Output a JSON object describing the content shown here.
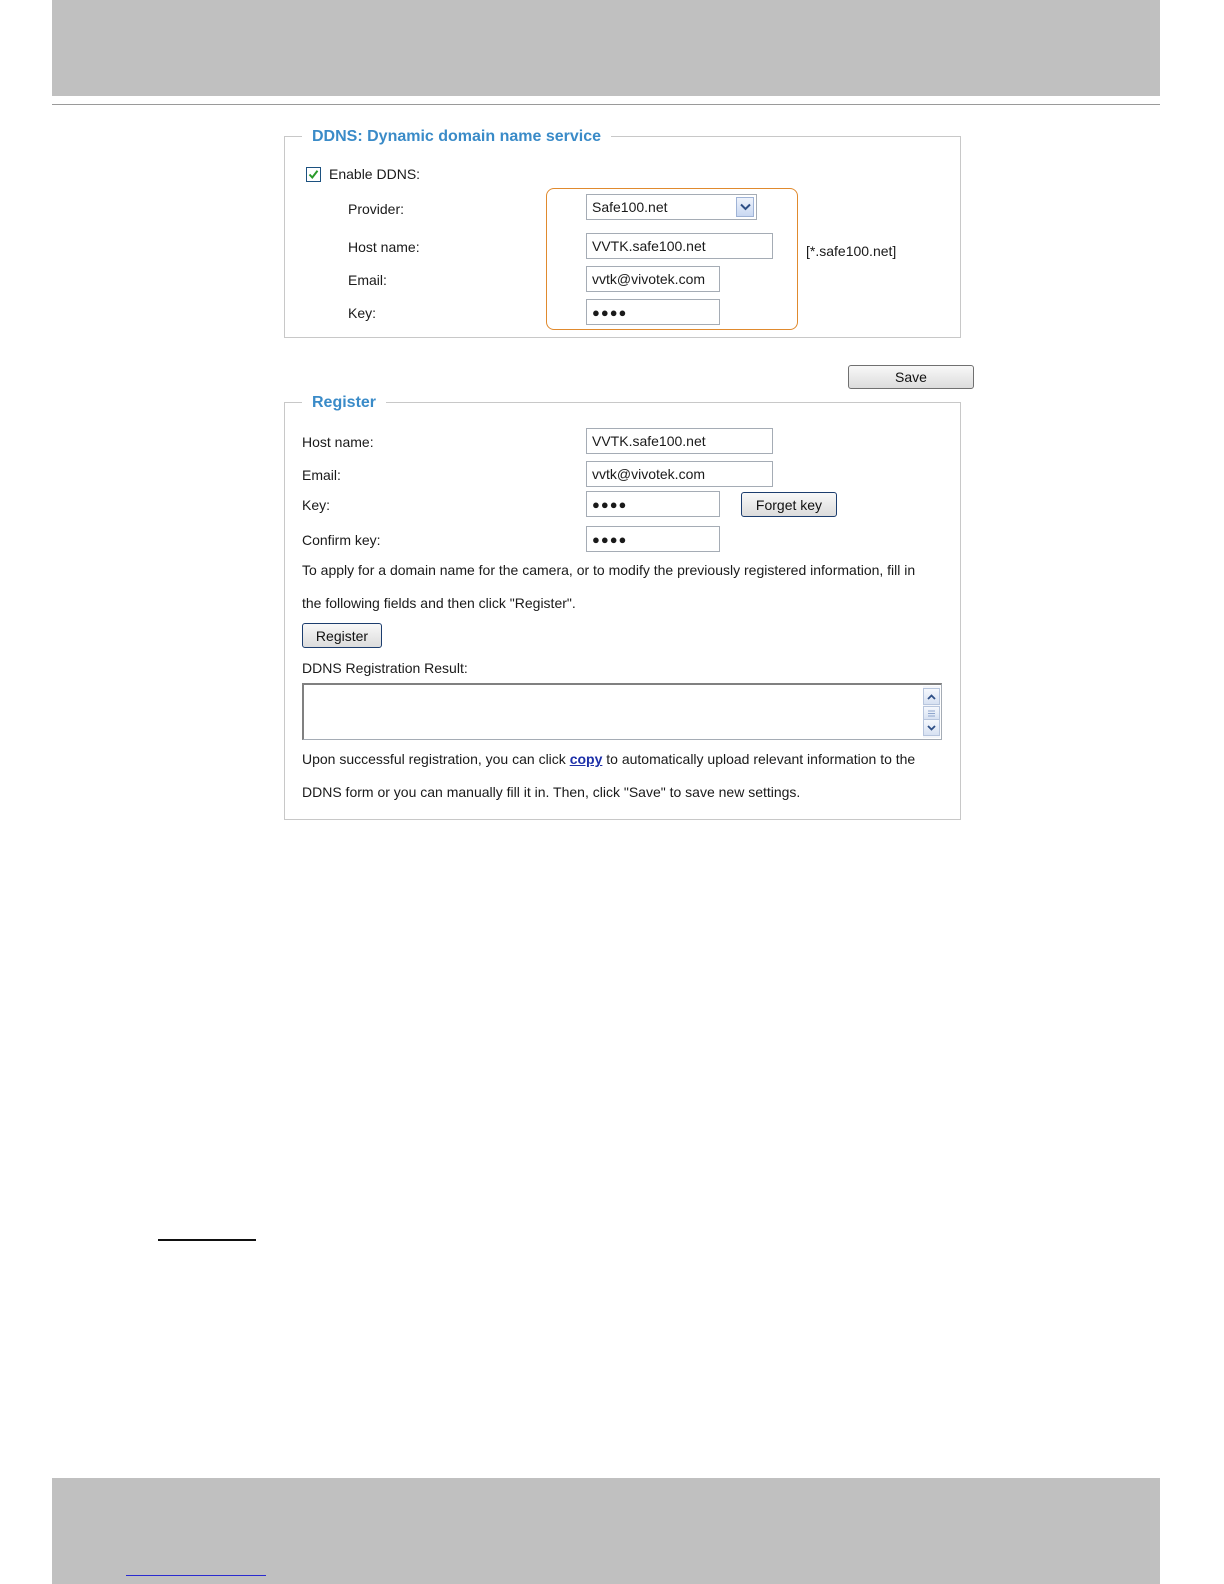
{
  "ddns": {
    "legend": "DDNS: Dynamic domain name service",
    "enable_label": "Enable DDNS:",
    "enabled": true,
    "provider_label": "Provider:",
    "provider_value": "Safe100.net",
    "hostname_label": "Host name:",
    "hostname_value": "VVTK.safe100.net",
    "hostname_hint": "[*.safe100.net]",
    "email_label": "Email:",
    "email_value": "vvtk@vivotek.com",
    "key_label": "Key:",
    "key_value": "●●●●"
  },
  "save_label": "Save",
  "register": {
    "legend": "Register",
    "hostname_label": "Host name:",
    "hostname_value": "VVTK.safe100.net",
    "email_label": "Email:",
    "email_value": "vvtk@vivotek.com",
    "key_label": "Key:",
    "key_value": "●●●●",
    "forget_key_label": "Forget key",
    "confirm_key_label": "Confirm key:",
    "confirm_key_value": "●●●●",
    "instruction_line1": "To apply for a domain name for the camera, or to modify the previously registered information, fill in",
    "instruction_line2": "the following fields and then click \"Register\".",
    "register_button_label": "Register",
    "result_label": "DDNS Registration Result:",
    "result_text": "",
    "note_part1": "Upon successful registration, you can click",
    "note_link": "copy",
    "note_part2": "to automatically upload relevant information to the",
    "note_line2": "DDNS form or you can manually fill it in. Then, click \"Save\" to save new settings."
  },
  "colors": {
    "legend": "#3a8bc8",
    "highlight": "#e08a2e",
    "band": "#c0c0c0",
    "link": "#1c2fa8"
  },
  "icons": {
    "checkbox": "checkmark-icon",
    "dropdown": "chevron-down-icon",
    "scroll_up": "chevron-up-icon",
    "scroll_down": "chevron-down-icon",
    "scroll_thumb": "grip-icon"
  }
}
